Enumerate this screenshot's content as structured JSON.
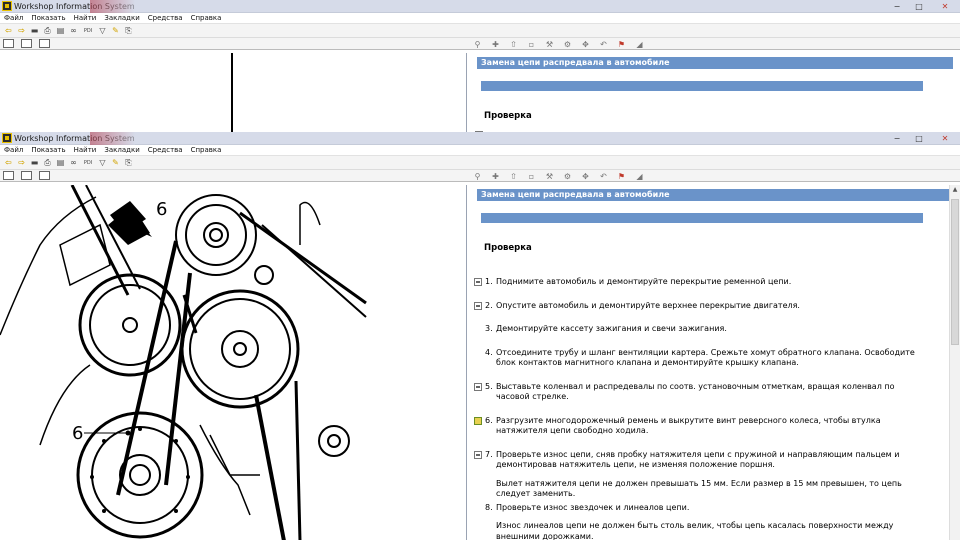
{
  "app": {
    "title": "Workshop Information System",
    "window_controls": {
      "minimize": "−",
      "maximize": "□",
      "close": "✕"
    }
  },
  "menu": [
    "Файл",
    "Показать",
    "Найти",
    "Закладки",
    "Средства",
    "Справка"
  ],
  "toolbar_icons": [
    "arrow-left-icon",
    "arrow-right-icon",
    "car-icon",
    "print-icon",
    "print-preview-icon",
    "binoculars-icon",
    "pdi-icon",
    "filter-icon",
    "pencil-icon",
    "bookmark-icon"
  ],
  "toolbar_pdi_label": "PDI",
  "document": {
    "header": "Замена цепи распредвала в автомобиле",
    "section_title": "Проверка",
    "steps": [
      {
        "number": "1.",
        "icon": "link",
        "text": "Поднимите автомобиль и демонтируйте перекрытие ременной цепи."
      },
      {
        "number": "2.",
        "icon": "link",
        "text": "Опустите автомобиль и демонтируйте верхнее перекрытие двигателя."
      },
      {
        "number": "3.",
        "icon": "none",
        "text": "Демонтируйте кассету зажигания и свечи зажигания."
      },
      {
        "number": "4.",
        "icon": "none",
        "text": "Отсоедините трубу и шланг вентиляции картера. Срежьте хомут обратного клапана. Освободите блок контактов магнитного клапана и демонтируйте крышку клапана."
      },
      {
        "number": "5.",
        "icon": "link",
        "text": "Выставьте коленвал и распредевалы по соотв. установочным отметкам, вращая коленвал по часовой стрелке."
      },
      {
        "number": "6.",
        "icon": "img",
        "text": "Разгрузите многодорожечный ремень и выкрутите винт реверсного колеса, чтобы втулка натяжителя цепи свободно ходила."
      },
      {
        "number": "7.",
        "icon": "link",
        "text": "Проверьте износ цепи, сняв пробку натяжителя цепи с пружиной и направляющим пальцем и демонтировав натяжитель цепи, не изменяя положение поршня.",
        "note": "Вылет натяжителя цепи не должен превышать 15 мм. Если размер в 15 мм превышен, то цепь следует заменить."
      },
      {
        "number": "8.",
        "icon": "none",
        "text": "Проверьте износ звездочек и линеалов цепи.",
        "note": "Износ линеалов цепи не должен быть столь велик, чтобы цепь касалась поверхности между внешними дорожками."
      }
    ]
  },
  "diagram": {
    "labels": [
      "6",
      "6"
    ]
  }
}
